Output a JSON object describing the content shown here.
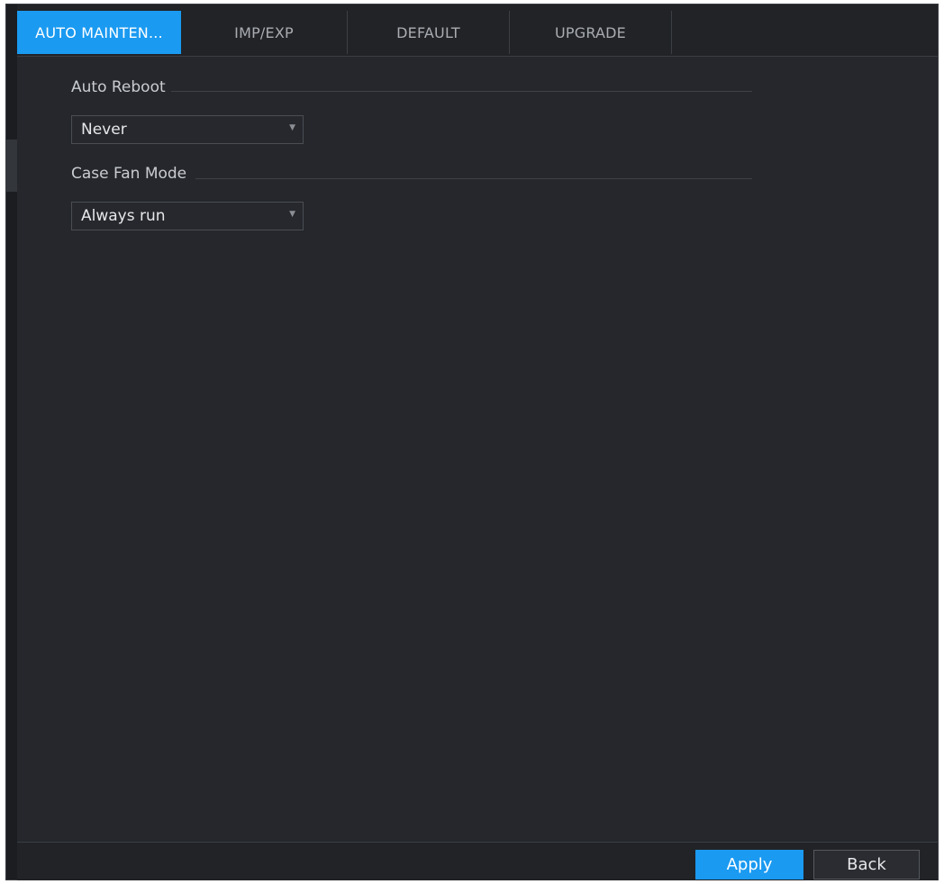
{
  "tabs": [
    {
      "label": "AUTO MAINTEN...",
      "active": true
    },
    {
      "label": "IMP/EXP",
      "active": false
    },
    {
      "label": "DEFAULT",
      "active": false
    },
    {
      "label": "UPGRADE",
      "active": false
    }
  ],
  "auto_reboot": {
    "label": "Auto Reboot",
    "value": "Never"
  },
  "case_fan_mode": {
    "label": "Case Fan Mode",
    "value": "Always run"
  },
  "footer": {
    "apply_label": "Apply",
    "back_label": "Back"
  },
  "colors": {
    "accent": "#1a9af1",
    "background": "#25272c",
    "tabbar": "#212327"
  },
  "icons": {
    "dropdown": "dropdown-arrow-icon"
  }
}
